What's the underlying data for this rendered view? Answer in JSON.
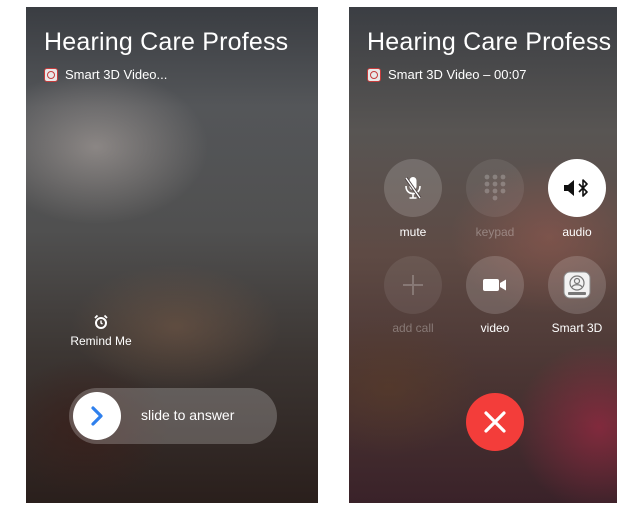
{
  "incoming_screen": {
    "caller_name": "Hearing Care Profess",
    "app_label": "Smart 3D Video...",
    "remind_label": "Remind Me",
    "slider_label": "slide to answer"
  },
  "active_screen": {
    "caller_name": "Hearing Care Profess",
    "app_label": "Smart 3D Video – 00:07",
    "buttons": [
      {
        "label": "mute",
        "icon": "mic-slash-icon",
        "state": "enabled"
      },
      {
        "label": "keypad",
        "icon": "keypad-icon",
        "state": "disabled"
      },
      {
        "label": "audio",
        "icon": "speaker-bluetooth-icon",
        "state": "active"
      },
      {
        "label": "add call",
        "icon": "plus-icon",
        "state": "disabled"
      },
      {
        "label": "video",
        "icon": "video-camera-icon",
        "state": "enabled"
      },
      {
        "label": "Smart 3D",
        "icon": "app-icon",
        "state": "enabled"
      }
    ],
    "end_call_icon": "close-x-icon"
  },
  "colors": {
    "end_call": "#f33d3a",
    "slider_arrow": "#2f80ed",
    "app_icon_accent": "#c43b3b"
  }
}
